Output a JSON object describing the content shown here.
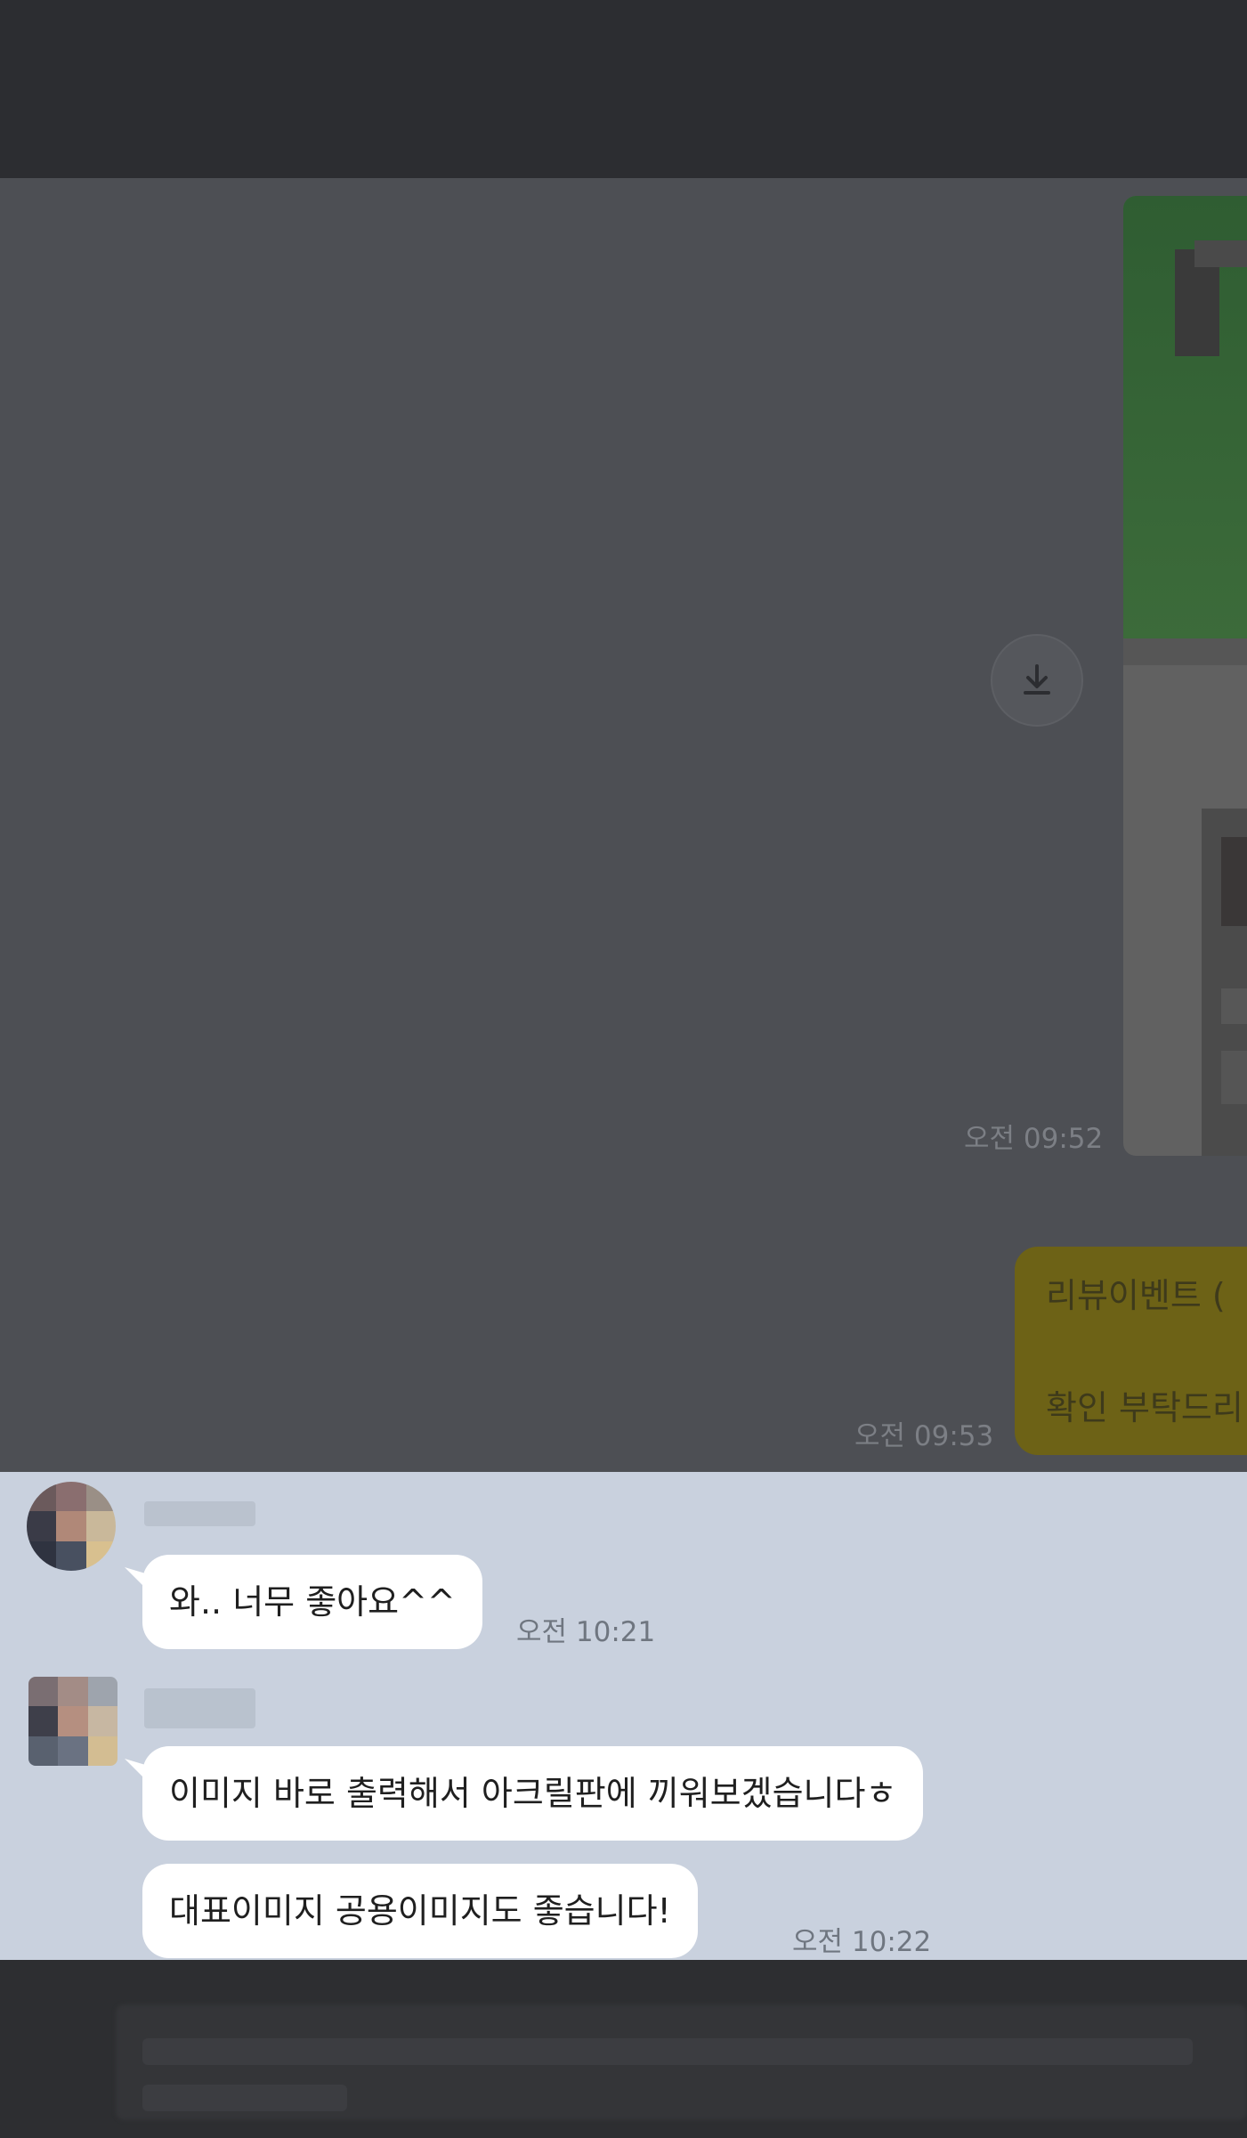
{
  "dimmed_thread": {
    "image_message": {
      "time": "오전 09:52"
    },
    "review_message": {
      "lines": [
        "리뷰이벤트 (",
        "확인 부탁드리"
      ],
      "time": "오전 09:53"
    }
  },
  "chat": {
    "messages": [
      {
        "text": "와.. 너무 좋아요^^",
        "time": "오전 10:21"
      },
      {
        "text": "이미지 바로 출력해서 아크릴판에 끼워보겠습니다ㅎ"
      },
      {
        "text": "대표이미지 공용이미지도 좋습니다!",
        "time": "오전 10:22"
      }
    ]
  },
  "icons": {
    "download": "download-icon"
  },
  "colors": {
    "top_bar": "#2c2d31",
    "dim_overlay": "#4d4f54",
    "chat_background": "#c9d1de",
    "incoming_bubble": "#ffffff",
    "outgoing_bubble_dimmed": "#6d6216"
  }
}
